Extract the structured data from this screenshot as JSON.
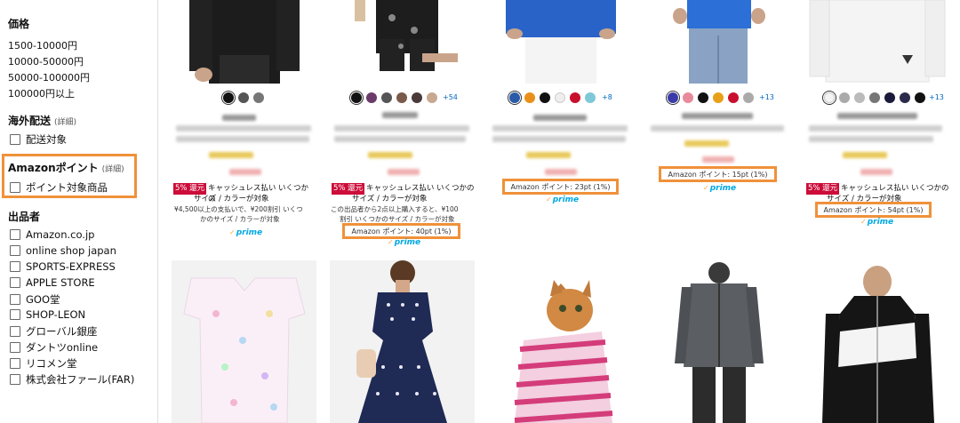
{
  "sidebar": {
    "price": {
      "title": "価格",
      "ranges": [
        "1500-10000円",
        "10000-50000円",
        "50000-100000円",
        "100000円以上"
      ]
    },
    "overseas": {
      "title": "海外配送",
      "detail": "(詳細)",
      "option": "配送対象"
    },
    "amazon_points": {
      "title": "Amazonポイント",
      "detail": "(詳細)",
      "option": "ポイント対象商品"
    },
    "sellers": {
      "title": "出品者",
      "items": [
        "Amazon.co.jp",
        "online shop japan",
        "SPORTS-EXPRESS",
        "APPLE STORE",
        "GOO堂",
        "SHOP-LEON",
        "グローバル銀座",
        "ダントツonline",
        "リコメン堂",
        "株式会社ファール(FAR)"
      ]
    }
  },
  "products_row1": [
    {
      "swatch_colors": [
        "#111111",
        "#555555",
        "#777777"
      ],
      "more_colors": "",
      "badge": "5% 還元",
      "promo_line1": "キャッシュレス払い いくつかの",
      "promo_line2": "サイズ / カラーが対象",
      "promo_small": [
        "¥4,500以上の支払いで、¥200割引 いくつ",
        "かのサイズ / カラーが対象"
      ],
      "points": "",
      "prime": "prime"
    },
    {
      "swatch_colors": [
        "#111111",
        "#6a3a6a",
        "#555555",
        "#7a5a4a",
        "#4a3a3a",
        "#c8a890"
      ],
      "more_colors": "+54",
      "badge": "5% 還元",
      "promo_line1": "キャッシュレス払い いくつかの",
      "promo_line2": "サイズ / カラーが対象",
      "promo_small": [
        "この出品者から2点以上購入すると、¥100",
        "割引 いくつかのサイズ / カラーが対象"
      ],
      "points": "Amazon ポイント: 40pt (1%)",
      "prime": "prime"
    },
    {
      "swatch_colors": [
        "#2a5aa8",
        "#e8901a",
        "#111111",
        "#eeeeee",
        "#c8102e",
        "#7ec8d8"
      ],
      "more_colors": "+8",
      "badge": "",
      "promo_line1": "",
      "promo_line2": "",
      "promo_small": [],
      "points": "Amazon ポイント: 23pt (1%)",
      "prime": "prime"
    },
    {
      "swatch_colors": [
        "#3a3aa8",
        "#e88a9a",
        "#111111",
        "#e8a01a",
        "#c8102e",
        "#aaaaaa"
      ],
      "more_colors": "+13",
      "badge": "",
      "promo_line1": "",
      "promo_line2": "",
      "promo_small": [],
      "points": "Amazon ポイント: 15pt (1%)",
      "prime": "prime"
    },
    {
      "swatch_colors": [
        "#f4f4f4",
        "#aaaaaa",
        "#bbbbbb",
        "#777777",
        "#1a1a3a",
        "#2a2a4a",
        "#111111"
      ],
      "more_colors": "+13",
      "badge": "5% 還元",
      "promo_line1": "キャッシュレス払い いくつかの",
      "promo_line2": "サイズ / カラーが対象",
      "promo_small": [],
      "points": "Amazon ポイント: 54pt (1%)",
      "prime": "prime"
    }
  ]
}
